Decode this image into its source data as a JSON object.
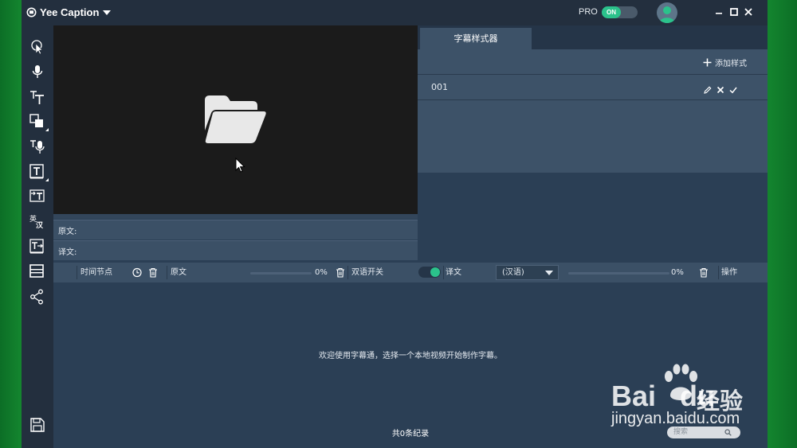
{
  "app": {
    "title": "Yee Caption",
    "pro_label": "PRO",
    "pro_toggle": "ON"
  },
  "toolbar": {
    "items": [
      {
        "icon": "pointer-icon"
      },
      {
        "icon": "microphone-icon"
      },
      {
        "icon": "text-size-icon"
      },
      {
        "icon": "shape-icon"
      },
      {
        "icon": "text-voice-icon"
      },
      {
        "icon": "text-box-icon"
      },
      {
        "icon": "text-import-icon"
      },
      {
        "icon": "translate-icon",
        "text_top": "英",
        "text_bottom": "汉"
      },
      {
        "icon": "text-export-icon"
      },
      {
        "icon": "film-strip-icon"
      },
      {
        "icon": "share-icon"
      },
      {
        "icon": "save-icon"
      }
    ]
  },
  "preview": {
    "source_label": "原文:",
    "translation_label": "译文:"
  },
  "style_panel": {
    "tab_label": "字幕样式器",
    "add_label": "添加样式",
    "styles": [
      {
        "name": "001"
      }
    ]
  },
  "table_header": {
    "time_node": "时间节点",
    "source": "原文",
    "source_progress": "0%",
    "source_progress_value": 0,
    "bilingual_switch": "双语开关",
    "translation": "译文",
    "language": "(汉语)",
    "translation_progress": "0%",
    "translation_progress_value": 0,
    "actions": "操作"
  },
  "list": {
    "welcome": "欢迎使用字幕通，选择一个本地视频开始制作字幕。",
    "record_count": "共0条纪录",
    "search_placeholder": "搜索"
  },
  "watermark": {
    "brand": "Bai",
    "brand_tail": "du",
    "cn": "经验",
    "url": "jingyan.baidu.com"
  },
  "colors": {
    "accent": "#2bc28b",
    "titlebar": "#232f3e",
    "panel": "#3d5268",
    "background": "#2b3f55"
  }
}
